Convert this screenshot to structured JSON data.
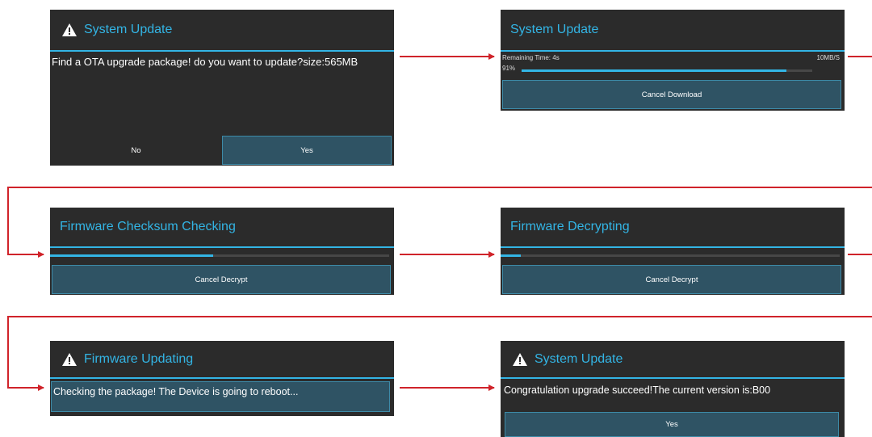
{
  "colors": {
    "accent": "#33b5e5",
    "dialog_bg": "#2b2b2b",
    "button_bg": "#2f5364",
    "arrow": "#d0232a"
  },
  "dialogs": {
    "d1": {
      "title": "System Update",
      "icon": "warning-icon",
      "message": "Find a OTA upgrade package! do you want to update?size:565MB",
      "no_label": "No",
      "yes_label": "Yes"
    },
    "d2": {
      "title": "System Update",
      "remaining": "Remaining Time: 4s",
      "speed": "10MB/S",
      "percent_label": "91%",
      "progress": 0.91,
      "button": "Cancel Download"
    },
    "d3": {
      "title": "Firmware Checksum Checking",
      "progress": 0.48,
      "button": "Cancel Decrypt"
    },
    "d4": {
      "title": "Firmware Decrypting",
      "progress": 0.06,
      "button": "Cancel Decrypt"
    },
    "d5": {
      "title": "Firmware Updating",
      "icon": "warning-icon",
      "message": "Checking the package! The Device is going to reboot..."
    },
    "d6": {
      "title": "System Update",
      "icon": "warning-icon",
      "message": "Congratulation upgrade succeed!The current version is:B00",
      "button": "Yes"
    }
  }
}
